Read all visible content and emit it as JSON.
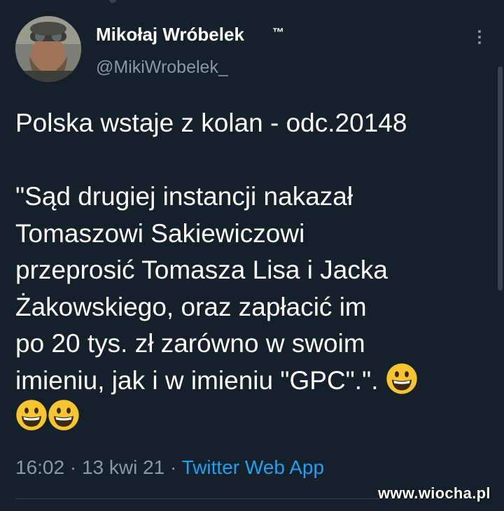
{
  "author": {
    "display_name": "Mikołaj Wróbelek",
    "trademark": "™",
    "handle": "@MikiWrobelek_"
  },
  "tweet": {
    "lines": [
      "Polska wstaje z kolan - odc.20148",
      "",
      "\"Sąd drugiej instancji nakazał",
      "Tomaszowi Sakiewiczowi",
      "przeprosić Tomasza Lisa i Jacka",
      "Żakowskiego, oraz zapłacić im",
      "po 20 tys. zł zarówno w swoim",
      "imieniu, jak i w imieniu \"GPC\".\"."
    ],
    "emoji_icon": "grinning-face-emoji",
    "emoji_count": 3
  },
  "meta": {
    "time": "16:02",
    "separator": " · ",
    "date": "13 kwi 21",
    "source": "Twitter Web App"
  },
  "watermark": "www.wiocha.pl",
  "colors": {
    "background": "#15202b",
    "text": "#ffffff",
    "secondary": "#8899a6",
    "link": "#1da1f2",
    "emoji": "#f7c62f"
  }
}
